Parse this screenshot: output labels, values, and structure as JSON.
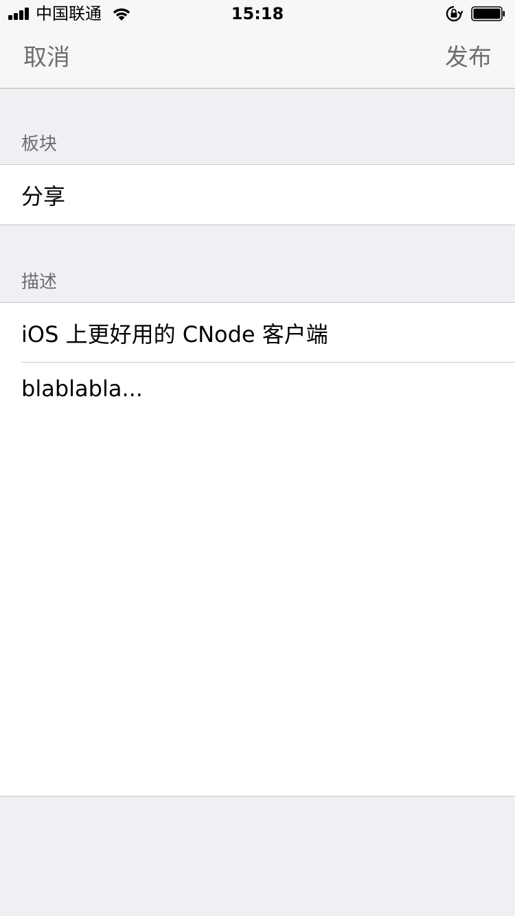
{
  "status_bar": {
    "carrier": "中国联通",
    "time": "15:18",
    "battery_level": 1.0,
    "signal_bars": 4
  },
  "nav": {
    "cancel_label": "取消",
    "publish_label": "发布"
  },
  "board_section": {
    "header": "板块",
    "value": "分享"
  },
  "description_section": {
    "header": "描述",
    "title_value": "iOS 上更好用的 CNode 客户端",
    "body_value": "blablabla..."
  },
  "icons": {
    "signal": "cellular-signal-icon",
    "wifi": "wifi-icon",
    "orientation_lock": "orientation-lock-icon",
    "battery": "battery-icon"
  }
}
